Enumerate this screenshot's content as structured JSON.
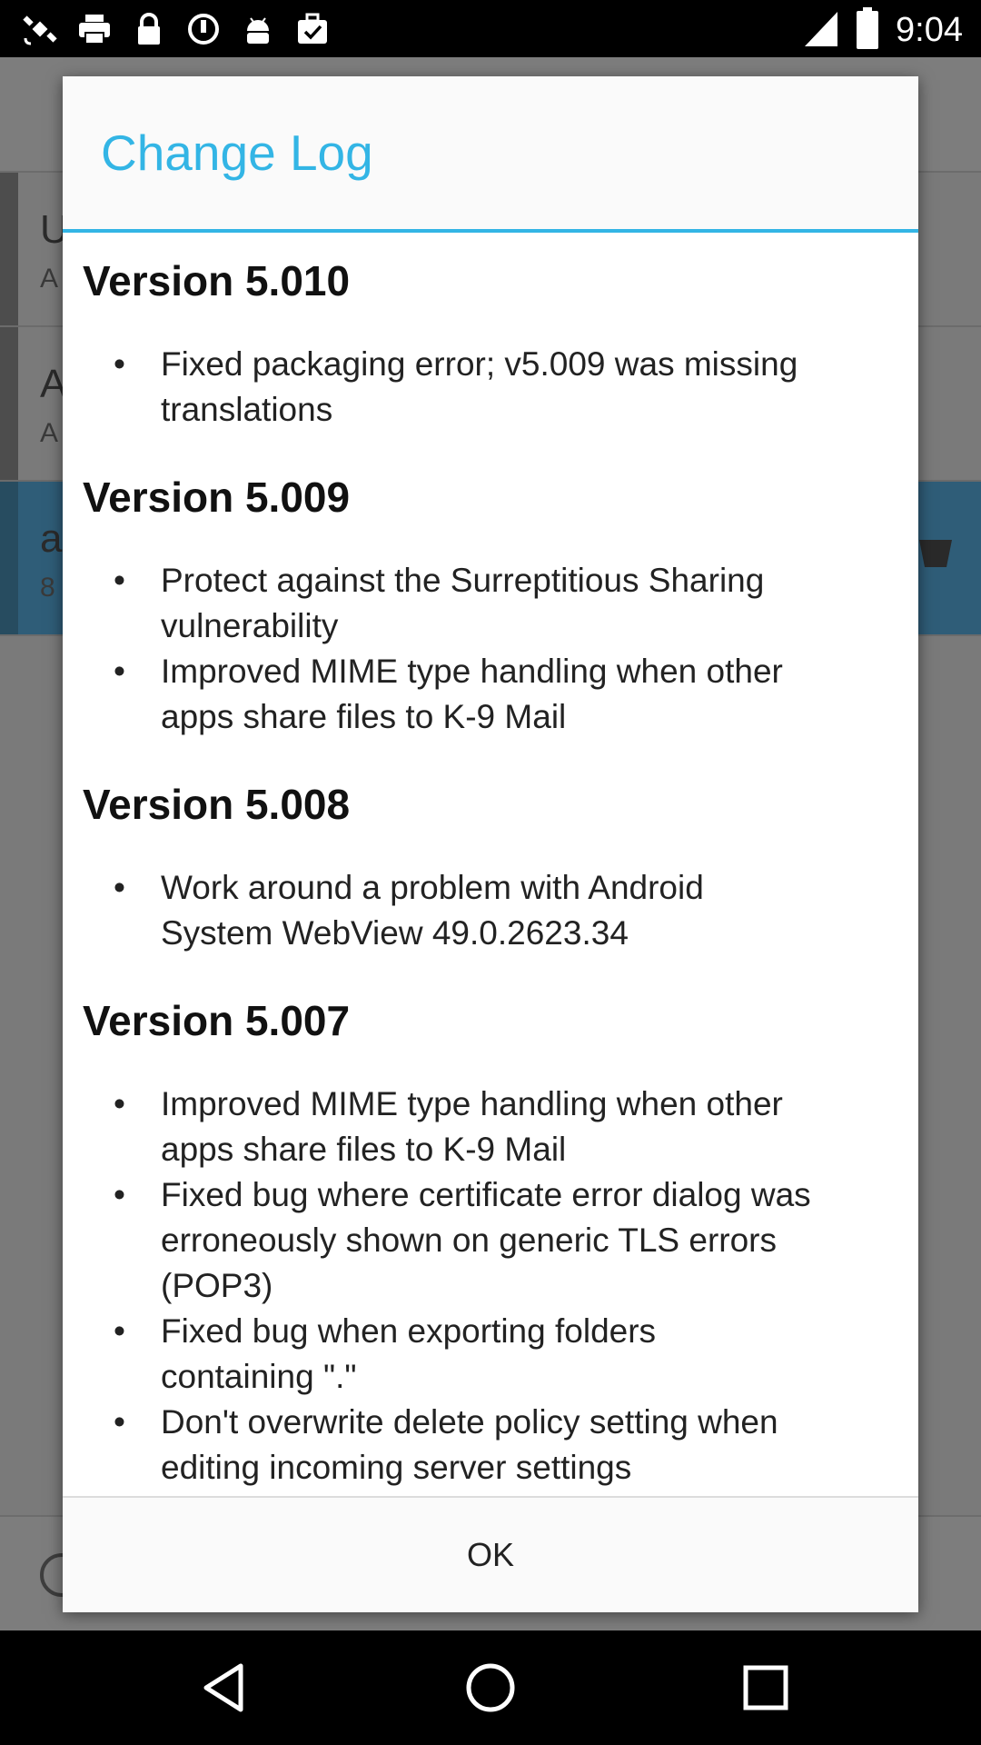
{
  "status_bar": {
    "time": "9:04",
    "left_icons": [
      "satellite-icon",
      "printer-icon",
      "lock-icon",
      "sync-icon",
      "android-icon",
      "briefcase-check-icon"
    ],
    "right_icons": [
      "signal-icon",
      "battery-icon"
    ]
  },
  "dialog": {
    "title": "Change Log",
    "versions": [
      {
        "title": "Version 5.010",
        "items": [
          [
            "Fixed packaging error; v5.009 was missing",
            "translations"
          ]
        ]
      },
      {
        "title": "Version 5.009",
        "items": [
          [
            "Protect against the Surreptitious Sharing",
            "vulnerability"
          ],
          [
            "Improved MIME type handling when other",
            "apps share files to K-9 Mail"
          ]
        ]
      },
      {
        "title": "Version 5.008",
        "items": [
          [
            "Work around a problem with Android",
            "System WebView 49.0.2623.34"
          ]
        ]
      },
      {
        "title": "Version 5.007",
        "items": [
          [
            "Improved MIME type handling when other",
            "apps share files to K-9 Mail"
          ],
          [
            "Fixed bug where certificate error dialog was",
            "erroneously shown on generic TLS errors",
            "(POP3)"
          ],
          [
            "Fixed bug when exporting folders",
            "containing \".\""
          ],
          [
            "Don't overwrite delete policy setting when",
            "editing incoming server settings"
          ]
        ]
      }
    ],
    "ok_label": "OK"
  },
  "background": {
    "rows": [
      {
        "line1": "U",
        "line2": "A"
      },
      {
        "line1": "A",
        "line2": "A"
      },
      {
        "line1": "a",
        "line2": "8"
      }
    ]
  },
  "nav_bar": {
    "icons": [
      "back-icon",
      "home-icon",
      "recents-icon"
    ]
  },
  "colors": {
    "accent": "#33b5e5"
  }
}
